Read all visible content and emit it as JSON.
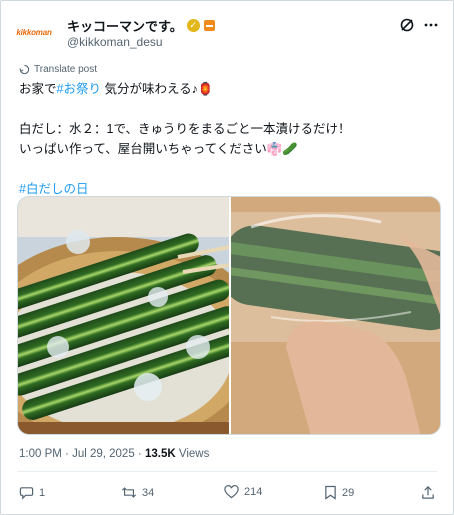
{
  "account": {
    "display_name": "キッコーマンです。",
    "handle": "@kikkoman_desu",
    "avatar_text": "kikkoman"
  },
  "tweet": {
    "translate_label": "Translate post",
    "line1_before": "お家で",
    "line1_hashtag": "#お祭り",
    "line1_after": " 気分が味わえる♪🏮",
    "line2": "白だし：水２：1で、きゅうりをまるごと一本漬けるだけ！",
    "line3": "いっぱい作って、屋台開いちゃってください👘🥒",
    "hashtag_line": "#白だしの日"
  },
  "meta": {
    "time": "1:00 PM",
    "separator": " · ",
    "date": "Jul 29, 2025",
    "views_count": "13.5K",
    "views_label": " Views"
  },
  "actions": {
    "replies": "1",
    "reposts": "34",
    "likes": "214",
    "bookmarks": "29"
  },
  "colors": {
    "accent": "#1d9bf0",
    "muted": "#536471",
    "verified": "#e2b719",
    "brand": "#e8690a"
  }
}
